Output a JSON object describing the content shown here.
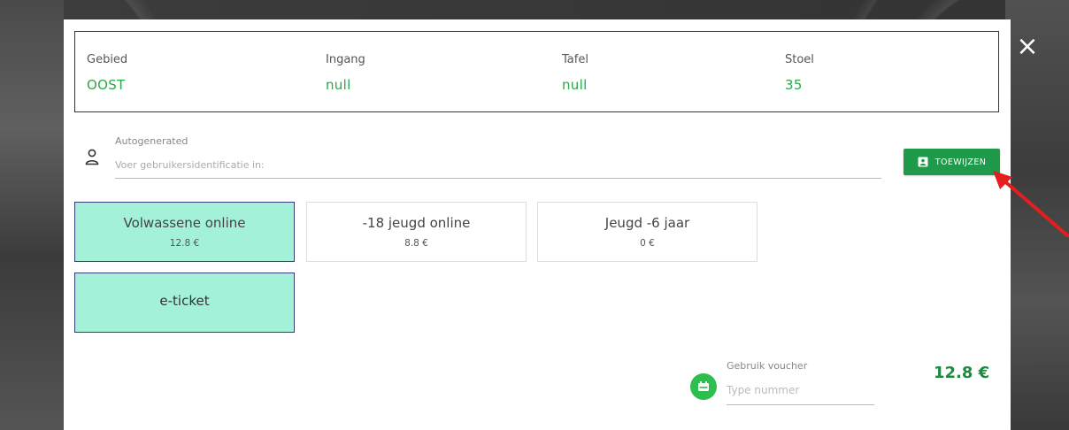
{
  "seat": {
    "area_label": "Gebied",
    "area_value": "OOST",
    "entrance_label": "Ingang",
    "entrance_value": "null",
    "table_label": "Tafel",
    "table_value": "null",
    "chair_label": "Stoel",
    "chair_value": "35"
  },
  "user": {
    "label": "Autogenerated",
    "placeholder": "Voer gebruikersidentificatie in:",
    "assign_label": "TOEWIJZEN"
  },
  "tickets": [
    {
      "name": "Volwassene online",
      "price": "12.8 €",
      "selected": true
    },
    {
      "name": "-18 jeugd online",
      "price": "8.8 €",
      "selected": false
    },
    {
      "name": "Jeugd -6 jaar",
      "price": "0 €",
      "selected": false
    }
  ],
  "delivery": {
    "name": "e-ticket",
    "selected": true
  },
  "voucher": {
    "label": "Gebruik voucher",
    "placeholder": "Type nummer"
  },
  "total": "12.8 €",
  "close_glyph": "×",
  "colors": {
    "accent": "#1f9a4a",
    "value_text": "#2aa84a",
    "selected_tile": "#a4f1d9",
    "annotation_arrow": "#e41e1e"
  },
  "icons": [
    "close-icon",
    "user-icon",
    "badge-icon",
    "voucher-icon",
    "arrow-annotation"
  ]
}
